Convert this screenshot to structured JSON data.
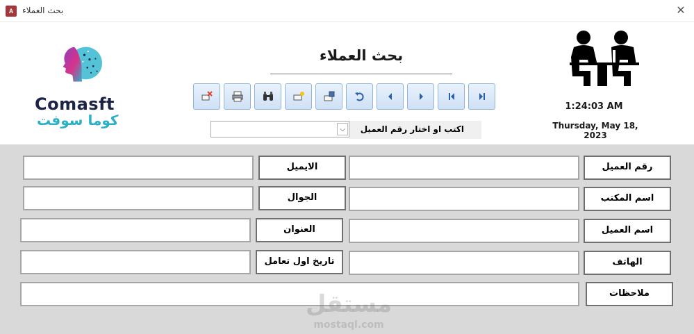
{
  "window": {
    "title": "بحث العملاء",
    "app_icon_text": "A"
  },
  "brand": {
    "name_en": "Comasft",
    "name_ar": "كوما سوفت"
  },
  "form": {
    "title": "بحث العملاء"
  },
  "toolbar": {
    "buttons": [
      {
        "name": "delete-record-button",
        "icon": "delete-icon"
      },
      {
        "name": "print-button",
        "icon": "printer-icon"
      },
      {
        "name": "find-button",
        "icon": "binoculars-icon"
      },
      {
        "name": "new-record-button",
        "icon": "new-record-icon"
      },
      {
        "name": "save-record-button",
        "icon": "save-icon"
      },
      {
        "name": "undo-button",
        "icon": "undo-icon"
      },
      {
        "name": "previous-record-button",
        "icon": "previous-icon"
      },
      {
        "name": "next-record-button",
        "icon": "next-icon"
      },
      {
        "name": "first-record-button",
        "icon": "first-icon"
      },
      {
        "name": "last-record-button",
        "icon": "last-icon"
      }
    ]
  },
  "clock": {
    "time": "1:24:03 AM",
    "date": "Thursday, May 18, 2023",
    "icon": "meeting-icon"
  },
  "search": {
    "label": "اكتب او اختار رقم العميل",
    "value": ""
  },
  "fields": {
    "customer_id": {
      "label": "رقم العميل",
      "value": ""
    },
    "office_name": {
      "label": "اسم المكتب",
      "value": ""
    },
    "customer_name": {
      "label": "اسم العميل",
      "value": ""
    },
    "phone": {
      "label": "الهاتف",
      "value": ""
    },
    "notes": {
      "label": "ملاحظات",
      "value": ""
    },
    "email": {
      "label": "الايميل",
      "value": ""
    },
    "mobile": {
      "label": "الجوال",
      "value": ""
    },
    "address": {
      "label": "العنوان",
      "value": ""
    },
    "first_deal_date": {
      "label": "تاريخ اول تعامل",
      "value": ""
    }
  },
  "watermark": {
    "ar": "مستقل",
    "en": "mostaql.com"
  }
}
